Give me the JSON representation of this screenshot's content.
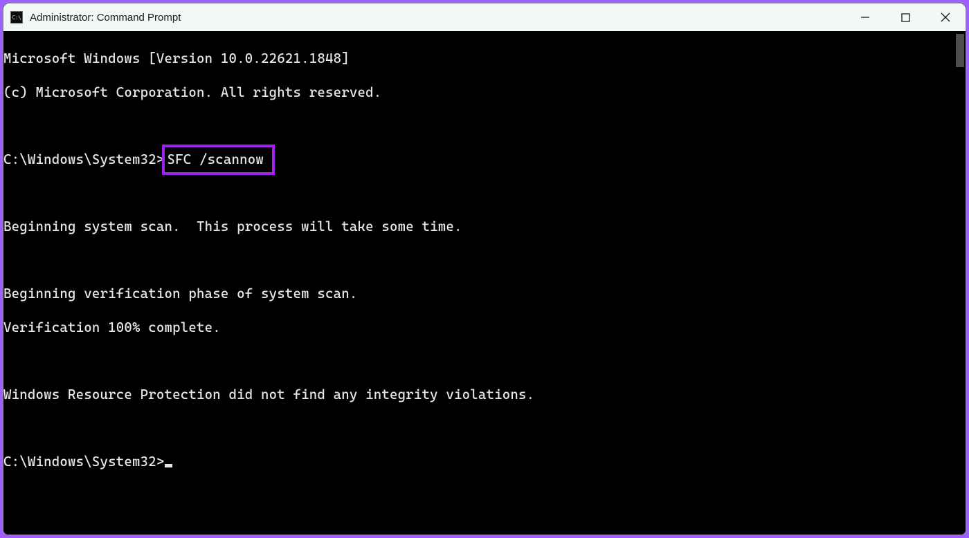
{
  "window": {
    "title": "Administrator: Command Prompt",
    "app_icon_text": "C:\\"
  },
  "console": {
    "line_version": "Microsoft Windows [Version 10.0.22621.1848]",
    "line_copyright": "(c) Microsoft Corporation. All rights reserved.",
    "blank": "",
    "prompt1_path": "C:\\Windows\\System32>",
    "prompt1_cmd": "SFC /scannow",
    "line_begin_scan": "Beginning system scan.  This process will take some time.",
    "line_verif_phase": "Beginning verification phase of system scan.",
    "line_verif_complete": "Verification 100% complete.",
    "line_result": "Windows Resource Protection did not find any integrity violations.",
    "prompt2_path": "C:\\Windows\\System32>"
  },
  "annotation": {
    "highlight_color": "#a020f0"
  }
}
